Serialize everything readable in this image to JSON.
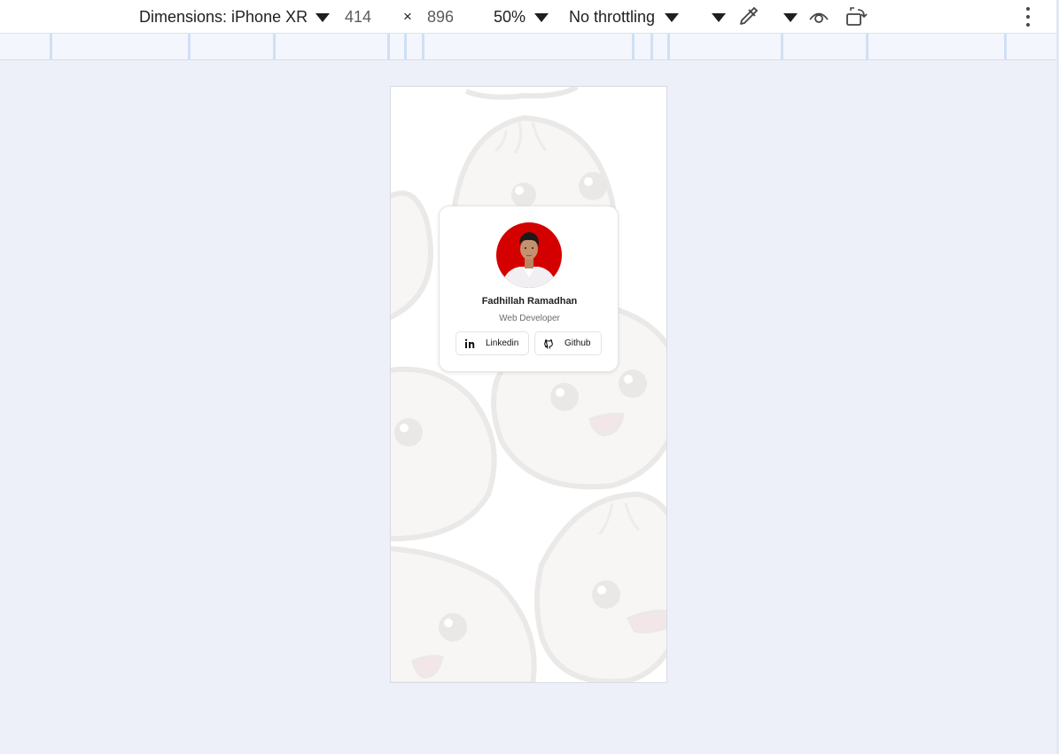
{
  "devtools_toolbar": {
    "dimensions_label": "Dimensions: iPhone XR",
    "width_value": "414",
    "times_symbol": "×",
    "height_value": "896",
    "zoom_label": "50%",
    "throttling_label": "No throttling",
    "icons": [
      "caret-down-icon",
      "eyedropper-icon",
      "eye-icon",
      "rotate-icon",
      "more-vert-icon"
    ]
  },
  "profile_card": {
    "name": "Fadhillah Ramadhan",
    "role": "Web Developer",
    "buttons": [
      {
        "label": "Linkedin",
        "icon": "linkedin-icon"
      },
      {
        "label": "Github",
        "icon": "github-icon"
      }
    ],
    "avatar_background": "#d40000"
  },
  "colors": {
    "page_background": "#edf0f9",
    "card_background": "#ffffff",
    "ruler_marks": "#cfe0f4"
  }
}
